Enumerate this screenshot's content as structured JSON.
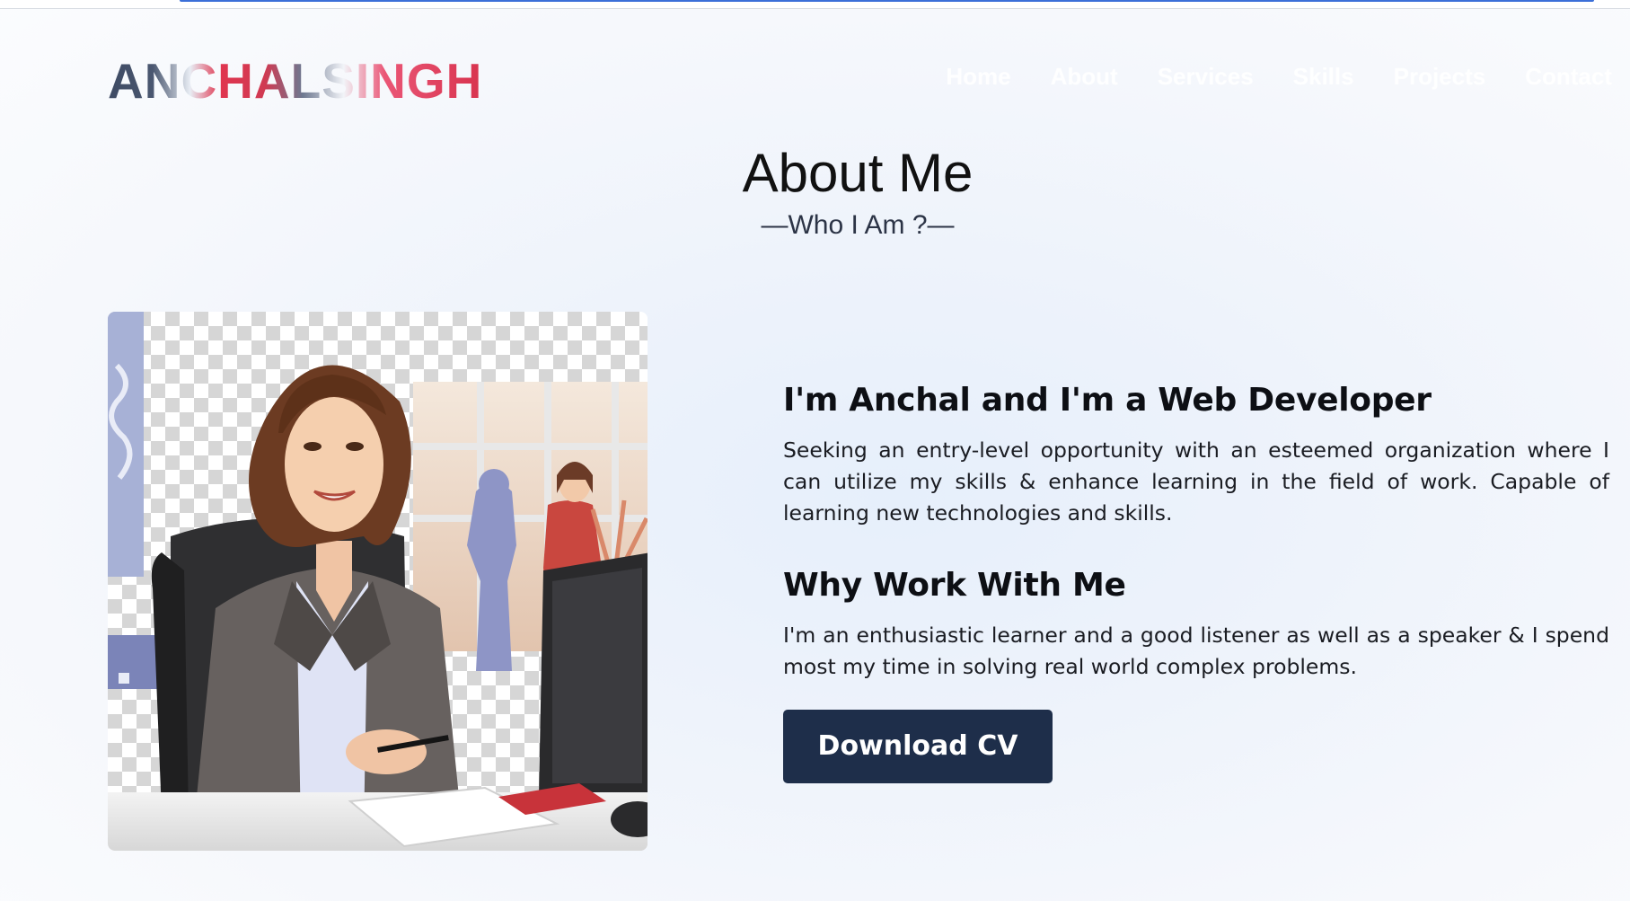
{
  "header": {
    "logo": "ANCHALSINGH",
    "nav": [
      "Home",
      "About",
      "Services",
      "Skills",
      "Projects",
      "Contact"
    ]
  },
  "section": {
    "title": "About Me",
    "subtitle": "—Who I Am ?—"
  },
  "about": {
    "intro_heading": "I'm Anchal and I'm a Web Developer",
    "intro_text": "Seeking an entry-level opportunity with an esteemed organization where I can utilize my skills & enhance learning in the field of work. Capable of learning new technologies and skills.",
    "why_heading": "Why Work With Me",
    "why_text": "I'm an enthusiastic learner and a good listener as well as a speaker & I spend most my time in solving real world complex problems.",
    "cta_label": "Download CV"
  },
  "colors": {
    "button_bg": "#1e2e4a",
    "logo_red": "#d8334e",
    "logo_slate": "#3e4a63"
  }
}
